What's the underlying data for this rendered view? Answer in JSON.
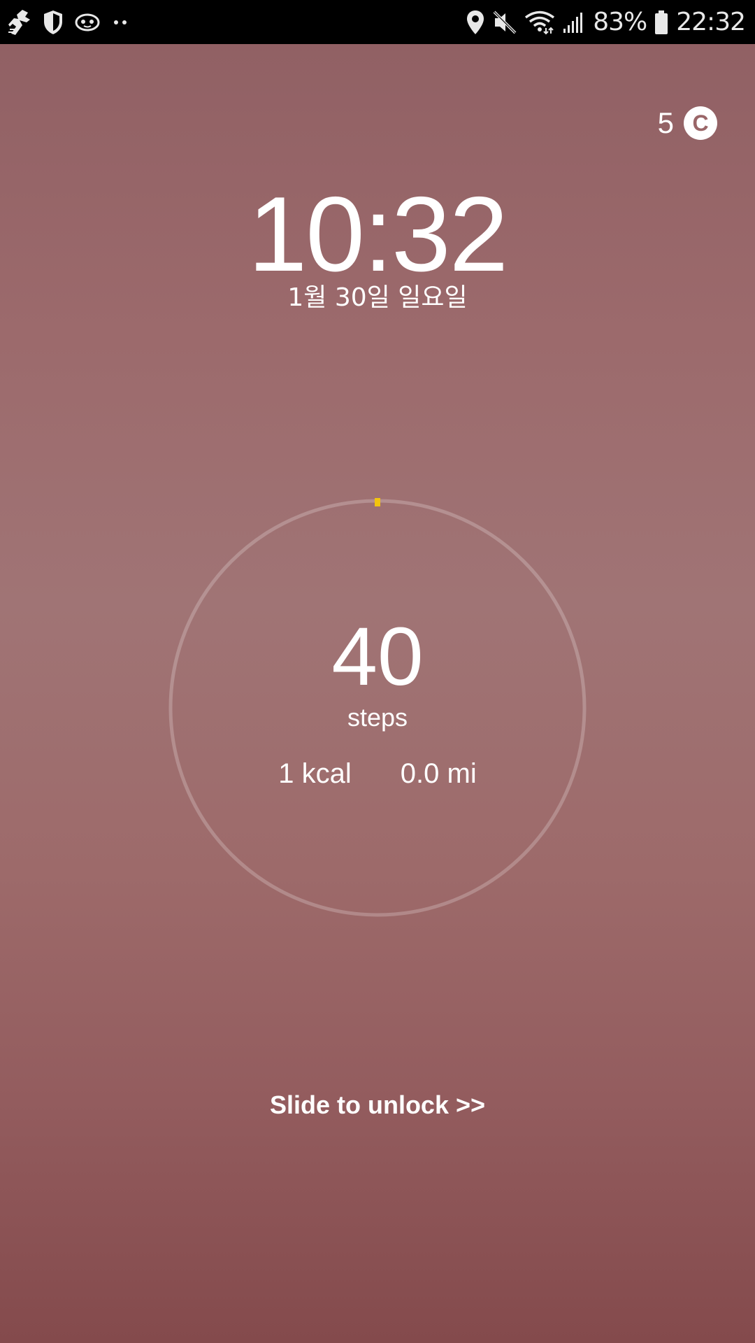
{
  "status_bar": {
    "left_icons": [
      "runner-app-icon",
      "shield-icon",
      "face-app-icon",
      "more-dots-icon"
    ],
    "right_icons": [
      "location-icon",
      "mute-icon",
      "wifi-icon",
      "signal-icon",
      "battery-icon"
    ],
    "battery_percent": "83%",
    "time": "22:32",
    "text_color": "#e8e8e8",
    "background": "#000000"
  },
  "weather": {
    "value": "5",
    "unit_badge": "C"
  },
  "lockscreen": {
    "time": "10:32",
    "date": "1월 30일 일요일"
  },
  "activity": {
    "steps": "40",
    "steps_label": "steps",
    "calories": "1 kcal",
    "distance": "0.0 mi",
    "progress_fraction": 0.0,
    "progress_color": "#f2c40f",
    "ring_color": "rgba(255,255,255,0.22)"
  },
  "unlock": {
    "label": "Slide to unlock >>"
  }
}
